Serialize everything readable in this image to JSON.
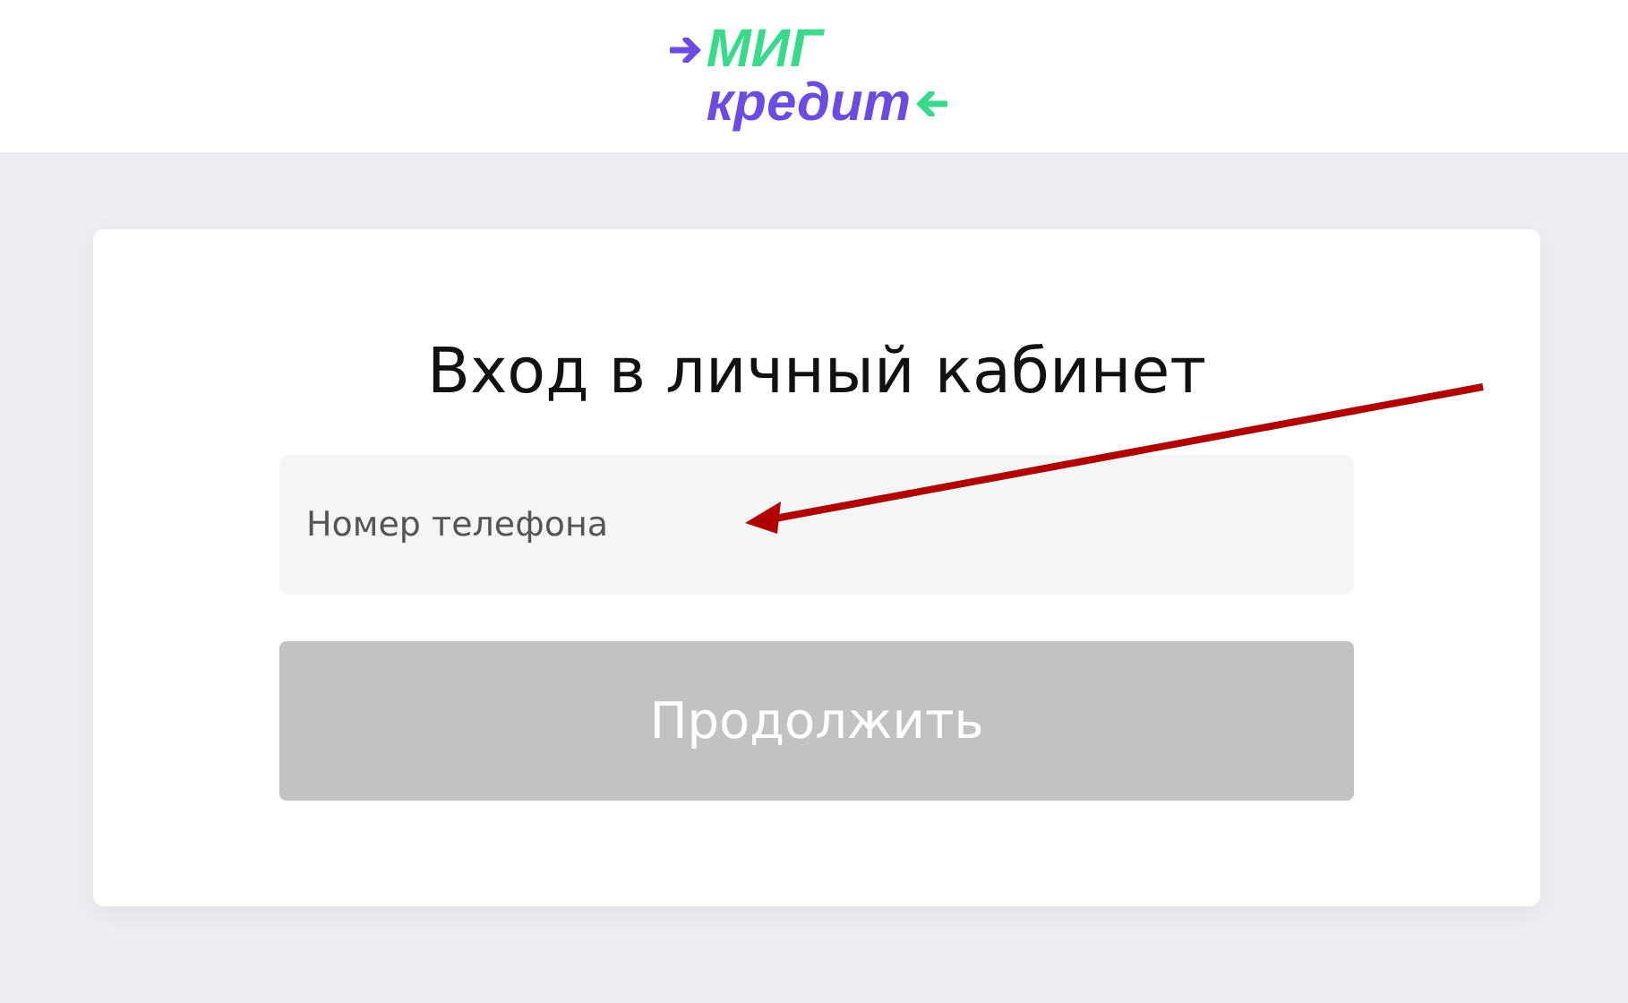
{
  "logo": {
    "top": "МИГ",
    "bottom": "кредит"
  },
  "title": "Вход в личный кабинет",
  "phone_field": {
    "placeholder": "Номер телефона"
  },
  "continue_button": {
    "label": "Продолжить",
    "disabled": true
  }
}
